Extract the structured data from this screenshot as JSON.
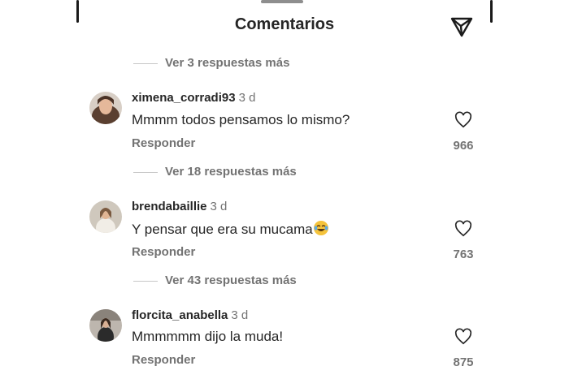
{
  "header": {
    "title": "Comentarios",
    "share_icon": "send-icon"
  },
  "top_replies": {
    "label": "Ver 3 respuestas más"
  },
  "comments": [
    {
      "username": "ximena_corradi93",
      "time": "3 d",
      "text": "Mmmm todos pensamos lo mismo?",
      "reply_label": "Responder",
      "likes": "966",
      "replies_label": "Ver 18 respuestas más"
    },
    {
      "username": "brendabaillie",
      "time": "3 d",
      "text": "Y pensar que era su mucama",
      "emoji": "laughing-tears-emoji",
      "reply_label": "Responder",
      "likes": "763",
      "replies_label": "Ver 43 respuestas más"
    },
    {
      "username": "florcita_anabella",
      "time": "3 d",
      "text": "Mmmmmm dijo la muda!",
      "reply_label": "Responder",
      "likes": "875"
    }
  ],
  "colors": {
    "primary_text": "#262626",
    "secondary_text": "#737373",
    "background": "#ffffff"
  }
}
